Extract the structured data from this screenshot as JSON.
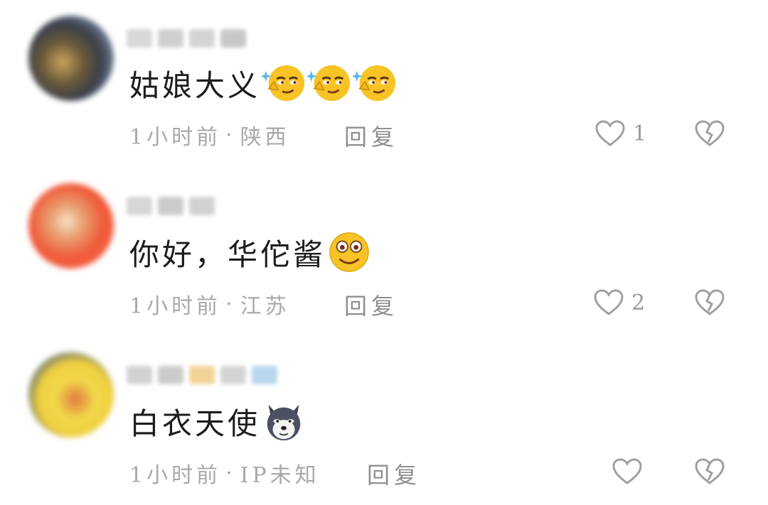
{
  "comments": [
    {
      "text": "姑娘大义",
      "emojis": [
        "smirk-emoji",
        "smirk-emoji",
        "smirk-emoji"
      ],
      "time": "1小时前",
      "location": "陕西",
      "reply_label": "回复",
      "like_count": "1",
      "avatar_colors": [
        "#3b3f4a",
        "#caa45a",
        "#7a8aa8"
      ]
    },
    {
      "text": "你好，华佗酱",
      "emojis": [
        "smile-emoji"
      ],
      "time": "1小时前",
      "location": "江苏",
      "reply_label": "回复",
      "like_count": "2",
      "avatar_colors": [
        "#f05a3a",
        "#e8a070",
        "#f7e0c8"
      ]
    },
    {
      "text": "白衣天使",
      "emojis": [
        "husky-dog-emoji"
      ],
      "time": "1小时前",
      "location": "IP未知",
      "reply_label": "回复",
      "like_count": "",
      "avatar_colors": [
        "#f2d84a",
        "#2a4a8a",
        "#e07840"
      ]
    }
  ],
  "separator": "·",
  "colors": {
    "text": "#1c1c1c",
    "meta": "#a9a9a9",
    "icon": "#a0a0a0"
  }
}
